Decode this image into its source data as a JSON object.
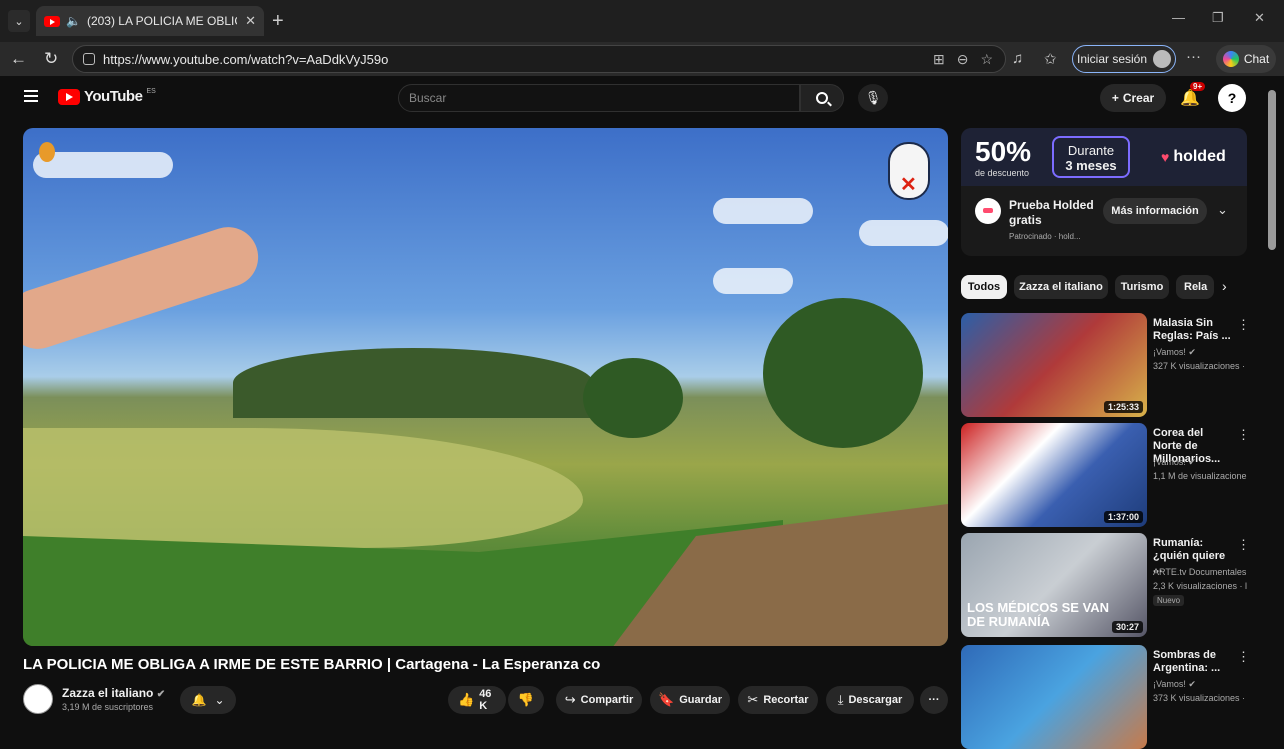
{
  "browser": {
    "tab_title": "(203) LA POLICIA ME OBLIGA",
    "url": "https://www.youtube.com/watch?v=AaDdkVyJ59o",
    "signin_label": "Iniciar sesión",
    "chat_label": "Chat"
  },
  "youtube": {
    "logo_text": "YouTube",
    "logo_country": "ES",
    "search_placeholder": "Buscar",
    "create_label": "Crear",
    "notification_count": "9+",
    "video": {
      "title": "LA POLICIA ME OBLIGA A IRME DE ESTE BARRIO | Cartagena - La Esperanza co",
      "channel": "Zazza el italiano",
      "subscribers": "3,19 M de suscriptores",
      "likes": "46 K",
      "actions": [
        "Compartir",
        "Guardar",
        "Recortar",
        "Descargar"
      ]
    },
    "ad": {
      "percent": "50%",
      "percent_desc": "de descuento",
      "duration_top": "Durante",
      "duration_bottom": "3 meses",
      "brand": "holded",
      "title": "Prueba Holded gratis",
      "sponsor": "Patrocinado · hold...",
      "cta": "Más información"
    },
    "chips": [
      "Todos",
      "Zazza el italiano",
      "Turismo",
      "Rela"
    ],
    "recommendations": [
      {
        "title": "Malasia Sin Reglas: País ...",
        "channel": "¡Vamos!",
        "views": "327 K visualizaciones ·",
        "duration": "1:25:33",
        "badge": ""
      },
      {
        "title": "Corea del Norte de Millonarios...",
        "channel": "¡Vamos!",
        "views": "1,1 M de visualizacione",
        "duration": "1:37:00",
        "badge": ""
      },
      {
        "title": "Rumanía: ¿quién quiere ...",
        "channel": "ARTE.tv Documentales",
        "views": "2,3 K visualizaciones · l",
        "duration": "30:27",
        "badge": "Nuevo",
        "overlay": "LOS MÉDICOS SE VAN DE RUMANÍA"
      },
      {
        "title": "Sombras de Argentina: ...",
        "channel": "¡Vamos!",
        "views": "373 K visualizaciones ·",
        "duration": "",
        "badge": ""
      }
    ]
  }
}
